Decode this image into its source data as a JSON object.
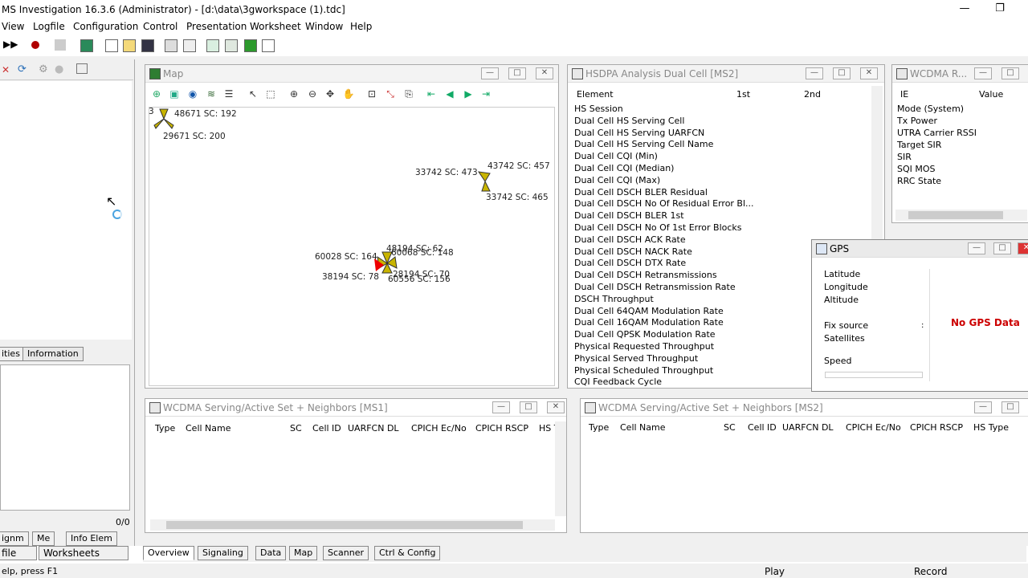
{
  "app": {
    "title": "MS Investigation 16.3.6 (Administrator) - [d:\\data\\3gworkspace (1).tdc]",
    "min": "—",
    "max": "❐"
  },
  "menu": [
    "View",
    "Logfile",
    "Configuration",
    "Control",
    "Presentation",
    "Worksheet",
    "Window",
    "Help"
  ],
  "left_tabs_top": [
    "ities",
    "Information"
  ],
  "left_counter": "0/0",
  "left_tabs_bottom": [
    "ignm",
    "Me",
    "Info Elem"
  ],
  "left_tabs_bottom2": [
    "file",
    "Worksheets"
  ],
  "map": {
    "title": "Map",
    "labels": [
      "3",
      "48671 SC: 192",
      "29671 SC: 200",
      "33742 SC: 473",
      "43742 SC: 457",
      "33742 SC: 465",
      "48194 SC: 62",
      "60068 SC: 148",
      "60028 SC: 164",
      "28194 SC: 70",
      "38194 SC: 78",
      "60556 SC: 156"
    ]
  },
  "hsdpa": {
    "title": "HSDPA Analysis Dual Cell [MS2]",
    "cols": [
      "Element",
      "1st",
      "2nd"
    ],
    "rows": [
      "HS Session",
      "Dual Cell HS Serving Cell",
      "Dual Cell HS Serving UARFCN",
      "Dual Cell HS Serving Cell Name",
      "Dual Cell CQI (Min)",
      "Dual Cell CQI (Median)",
      "Dual Cell CQI (Max)",
      "Dual Cell DSCH BLER Residual",
      "Dual Cell DSCH No Of Residual Error Bl...",
      "Dual Cell DSCH BLER 1st",
      "Dual Cell DSCH No Of 1st Error Blocks",
      "Dual Cell DSCH ACK Rate",
      "Dual Cell DSCH NACK Rate",
      "Dual Cell DSCH DTX Rate",
      "Dual Cell DSCH Retransmissions",
      "Dual Cell DSCH Retransmission Rate",
      "DSCH Throughput",
      "Dual Cell 64QAM Modulation Rate",
      "Dual Cell 16QAM Modulation Rate",
      "Dual Cell QPSK Modulation Rate",
      "Physical Requested Throughput",
      "Physical Served Throughput",
      "Physical Scheduled Throughput",
      "CQI Feedback Cycle"
    ]
  },
  "wcdmar": {
    "title": "WCDMA R...",
    "cols": [
      "IE",
      "Value"
    ],
    "rows": [
      "Mode (System)",
      "Tx Power",
      "UTRA Carrier RSSI",
      "Target SIR",
      "SIR",
      "SQI MOS",
      "RRC State"
    ]
  },
  "gps": {
    "title": "GPS",
    "rows": [
      "Latitude",
      "Longitude",
      "Altitude",
      "Fix source",
      "Satellites",
      "Speed"
    ],
    "nodata": "No GPS Data",
    "dot": ":"
  },
  "serv1": {
    "title": "WCDMA Serving/Active Set + Neighbors [MS1]",
    "cols": [
      "Type",
      "Cell Name",
      "SC",
      "Cell ID",
      "UARFCN DL",
      "CPICH Ec/No",
      "CPICH RSCP",
      "HS T"
    ]
  },
  "serv2": {
    "title": "WCDMA Serving/Active Set + Neighbors [MS2]",
    "cols": [
      "Type",
      "Cell Name",
      "SC",
      "Cell ID",
      "UARFCN DL",
      "CPICH Ec/No",
      "CPICH RSCP",
      "HS Type"
    ]
  },
  "bottom_tabs": [
    "Overview",
    "Signaling",
    "Data",
    "Map",
    "Scanner",
    "Ctrl & Config"
  ],
  "status": {
    "help": "elp, press F1",
    "play": "Play",
    "record": "Record"
  },
  "colors": {
    "accent": "#cc0000",
    "tabbar": "#f0f0f0"
  }
}
